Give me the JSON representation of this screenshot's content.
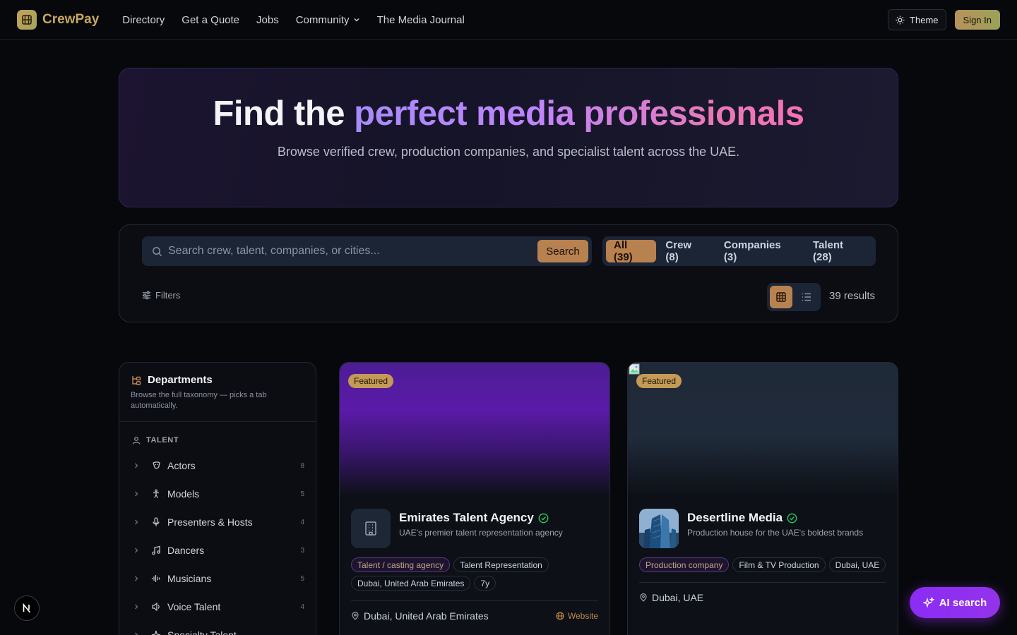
{
  "nav": {
    "brand": "CrewPay",
    "links": [
      "Directory",
      "Get a Quote",
      "Jobs",
      "Community",
      "The Media Journal"
    ],
    "theme_label": "Theme",
    "signin_label": "Sign In"
  },
  "hero": {
    "title_plain": "Find the ",
    "title_highlight": "perfect media professionals",
    "subtitle": "Browse verified crew, production companies, and specialist talent across the UAE."
  },
  "search": {
    "placeholder": "Search crew, talent, companies, or cities...",
    "button_label": "Search",
    "tabs": [
      "All (39)",
      "Crew (8)",
      "Companies (3)",
      "Talent (28)"
    ],
    "active_tab": "All (39)",
    "filters_label": "Filters",
    "results_label": "39 results"
  },
  "sidebar": {
    "title": "Departments",
    "description": "Browse the full taxonomy — picks a tab automatically.",
    "section": "TALENT",
    "items": [
      {
        "label": "Actors",
        "count": "8"
      },
      {
        "label": "Models",
        "count": "5"
      },
      {
        "label": "Presenters & Hosts",
        "count": "4"
      },
      {
        "label": "Dancers",
        "count": "3"
      },
      {
        "label": "Musicians",
        "count": "5"
      },
      {
        "label": "Voice Talent",
        "count": "4"
      },
      {
        "label": "Specialty Talent",
        "count": ""
      }
    ]
  },
  "cards": [
    {
      "featured": "Featured",
      "name": "Emirates Talent Agency",
      "tagline": "UAE's premier talent representation agency",
      "chips": [
        "Talent / casting agency",
        "Talent Representation",
        "Dubai, United Arab Emirates",
        "7y"
      ],
      "location": "Dubai, United Arab Emirates",
      "website": "Website"
    },
    {
      "featured": "Featured",
      "name": "Desertline Media",
      "tagline": "Production house for the UAE's boldest brands",
      "chips": [
        "Production company",
        "Film & TV Production",
        "Dubai, UAE"
      ],
      "location": "Dubai, UAE",
      "website": ""
    }
  ],
  "floating": {
    "ai_search_label": "AI search",
    "next_badge": "N"
  },
  "colors": {
    "accent": "#b88150",
    "brand": "#c9a860",
    "ai": "#9333ea",
    "verified": "#22c55e"
  }
}
